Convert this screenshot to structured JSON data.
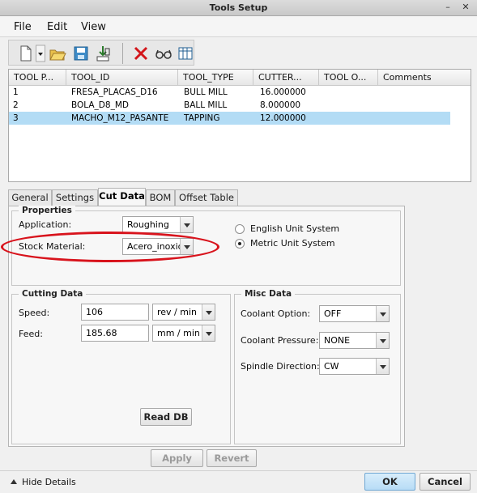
{
  "window": {
    "title": "Tools Setup",
    "btn_min": "–",
    "btn_close": "✕"
  },
  "menu": [
    "File",
    "Edit",
    "View"
  ],
  "toolbar": {
    "icons": [
      "new-file-icon",
      "dropdown-arrow-icon",
      "open-folder-icon",
      "save-icon",
      "import-icon",
      "delete-icon",
      "glasses-icon",
      "table-icon"
    ]
  },
  "table": {
    "headers": [
      "TOOL P...",
      "TOOL_ID",
      "TOOL_TYPE",
      "CUTTER...",
      "TOOL O...",
      "Comments"
    ],
    "rows": [
      [
        "1",
        "FRESA_PLACAS_D16",
        "BULL MILL",
        "16.000000",
        "",
        ""
      ],
      [
        "2",
        "BOLA_D8_MD",
        "BALL MILL",
        "8.000000",
        "",
        ""
      ],
      [
        "3",
        "MACHO_M12_PASANTE",
        "TAPPING",
        "12.000000",
        "",
        ""
      ]
    ],
    "selected_row": 2
  },
  "tabs": [
    "General",
    "Settings",
    "Cut Data",
    "BOM",
    "Offset Table"
  ],
  "active_tab": "Cut Data",
  "properties": {
    "legend": "Properties",
    "application_label": "Application:",
    "application_value": "Roughing",
    "stock_label": "Stock Material:",
    "stock_value": "Acero_inoxid",
    "english_label": "English Unit System",
    "metric_label": "Metric Unit System",
    "unit_selected": "metric"
  },
  "cutting": {
    "legend": "Cutting Data",
    "speed_label": "Speed:",
    "speed_value": "106",
    "speed_unit": "rev / min",
    "feed_label": "Feed:",
    "feed_value": "185.68",
    "feed_unit": "mm / min",
    "read_db": "Read DB"
  },
  "misc": {
    "legend": "Misc Data",
    "coolant_option_label": "Coolant Option:",
    "coolant_option_value": "OFF",
    "coolant_pressure_label": "Coolant Pressure:",
    "coolant_pressure_value": "NONE",
    "spindle_label": "Spindle Direction:",
    "spindle_value": "CW"
  },
  "actions": {
    "apply": "Apply",
    "revert": "Revert"
  },
  "footer": {
    "hide_details": "Hide Details",
    "ok": "OK",
    "cancel": "Cancel"
  },
  "colors": {
    "selection": "#b3dcf5",
    "annotation": "#d8131c"
  }
}
